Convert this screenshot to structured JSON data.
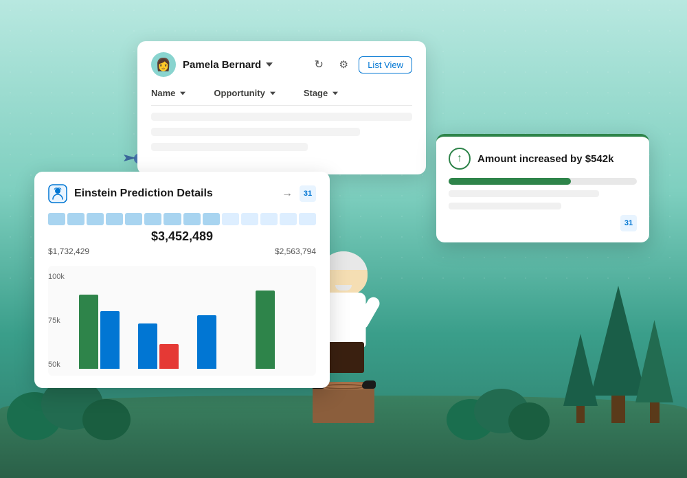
{
  "background": {
    "gradient_start": "#b8e8e0",
    "gradient_end": "#2d7a68"
  },
  "card_salesforce": {
    "user_name": "Pamela Bernard",
    "dropdown_label": "▾",
    "list_view_btn": "List View",
    "columns": [
      {
        "label": "Name",
        "sort": true
      },
      {
        "label": "Opportunity",
        "sort": true
      },
      {
        "label": "Stage",
        "sort": true
      }
    ],
    "rows": [
      {
        "name_placeholder": "",
        "opp_placeholder": "",
        "stage_placeholder": ""
      },
      {
        "name_placeholder": "",
        "opp_placeholder": "",
        "stage_placeholder": ""
      }
    ]
  },
  "card_einstein": {
    "icon_label": "einstein-icon",
    "title": "Einstein Prediction Details",
    "arrow": "→",
    "calendar_label": "31",
    "progress_blocks": 14,
    "progress_value": "$3,452,489",
    "range_min": "$1,732,429",
    "range_max": "$2,563,794",
    "chart": {
      "y_labels": [
        "100k",
        "75k",
        "50k"
      ],
      "bar_groups": [
        {
          "bars": [
            {
              "color": "#2e844a",
              "height": 90
            },
            {
              "color": "#0176d3",
              "height": 70
            }
          ]
        },
        {
          "bars": [
            {
              "color": "#0176d3",
              "height": 55
            },
            {
              "color": "#e53935",
              "height": 30
            }
          ]
        },
        {
          "bars": [
            {
              "color": "#0176d3",
              "height": 65
            }
          ]
        },
        {
          "bars": [
            {
              "color": "#2e844a",
              "height": 95
            }
          ]
        }
      ]
    }
  },
  "card_amount": {
    "title": "Amount increased by $542k",
    "bar_fill_percent": 65,
    "calendar_label": "31",
    "bar_accent_color": "#2e844a",
    "rows": 2
  },
  "user_avatar_emoji": "👩",
  "bird_color": "#4a7ab5"
}
